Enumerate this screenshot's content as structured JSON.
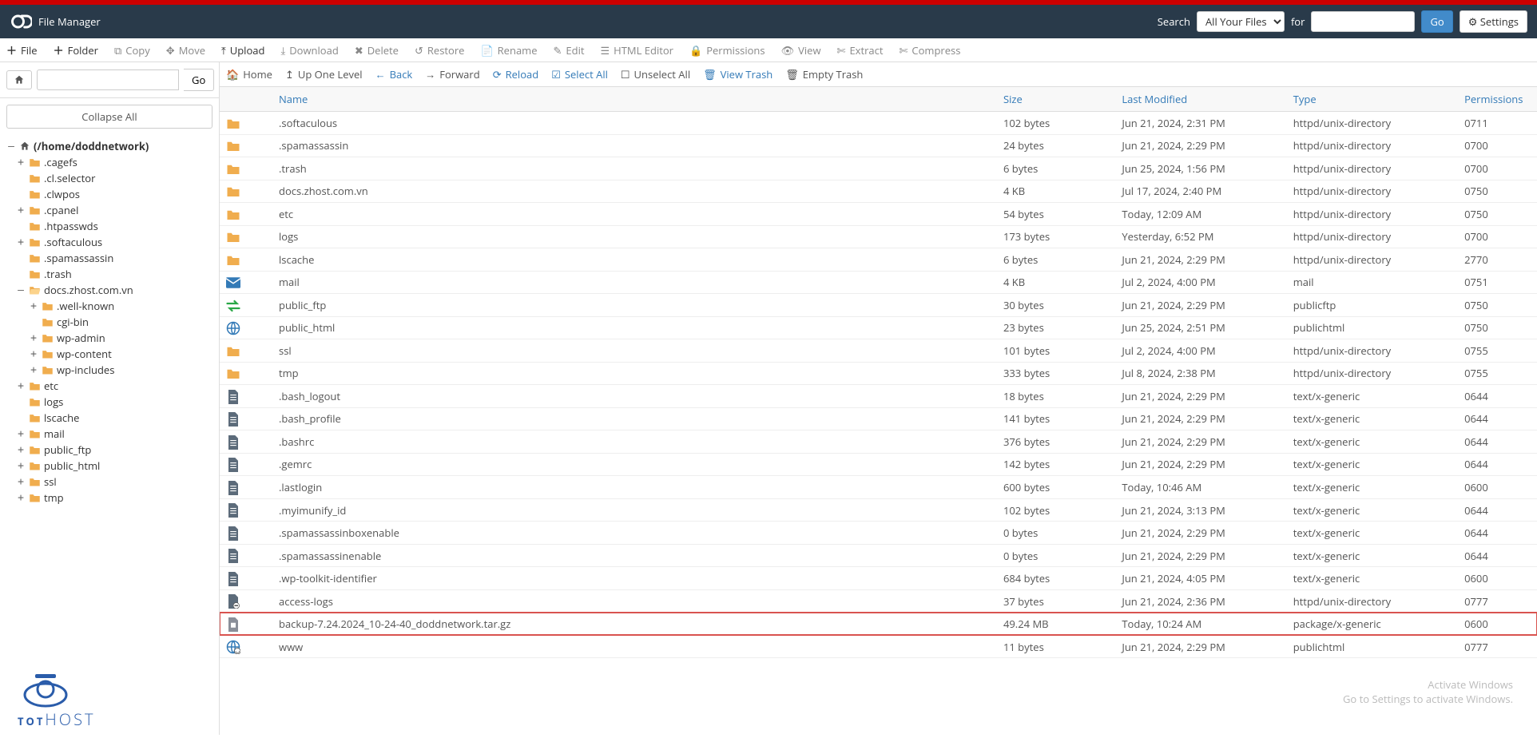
{
  "app_title": "File Manager",
  "search": {
    "label": "Search",
    "scope": "All Your Files",
    "for": "for",
    "go": "Go"
  },
  "settings_label": "Settings",
  "top_actions": [
    {
      "label": "File",
      "enabled": true,
      "icon": "plus"
    },
    {
      "label": "Folder",
      "enabled": true,
      "icon": "plus"
    },
    {
      "label": "Copy",
      "enabled": false,
      "icon": "copy"
    },
    {
      "label": "Move",
      "enabled": false,
      "icon": "move"
    },
    {
      "label": "Upload",
      "enabled": true,
      "icon": "upload"
    },
    {
      "label": "Download",
      "enabled": false,
      "icon": "download"
    },
    {
      "label": "Delete",
      "enabled": false,
      "icon": "x"
    },
    {
      "label": "Restore",
      "enabled": false,
      "icon": "restore"
    },
    {
      "label": "Rename",
      "enabled": false,
      "icon": "rename"
    },
    {
      "label": "Edit",
      "enabled": false,
      "icon": "edit"
    },
    {
      "label": "HTML Editor",
      "enabled": false,
      "icon": "html"
    },
    {
      "label": "Permissions",
      "enabled": false,
      "icon": "lock"
    },
    {
      "label": "View",
      "enabled": false,
      "icon": "eye"
    },
    {
      "label": "Extract",
      "enabled": false,
      "icon": "extract"
    },
    {
      "label": "Compress",
      "enabled": false,
      "icon": "compress"
    }
  ],
  "left": {
    "go": "Go",
    "collapse": "Collapse All",
    "root": "(/home/doddnetwork)",
    "tree": [
      {
        "d": 0,
        "tog": "–",
        "icon": "home",
        "label": "(/home/doddnetwork)",
        "bold": true,
        "open": true
      },
      {
        "d": 1,
        "tog": "+",
        "icon": "folder",
        "label": ".cagefs"
      },
      {
        "d": 1,
        "tog": "",
        "icon": "folder",
        "label": ".cl.selector"
      },
      {
        "d": 1,
        "tog": "",
        "icon": "folder",
        "label": ".clwpos"
      },
      {
        "d": 1,
        "tog": "+",
        "icon": "folder",
        "label": ".cpanel"
      },
      {
        "d": 1,
        "tog": "",
        "icon": "folder",
        "label": ".htpasswds"
      },
      {
        "d": 1,
        "tog": "+",
        "icon": "folder",
        "label": ".softaculous"
      },
      {
        "d": 1,
        "tog": "",
        "icon": "folder",
        "label": ".spamassassin"
      },
      {
        "d": 1,
        "tog": "",
        "icon": "folder",
        "label": ".trash"
      },
      {
        "d": 1,
        "tog": "–",
        "icon": "folder-open",
        "label": "docs.zhost.com.vn"
      },
      {
        "d": 2,
        "tog": "+",
        "icon": "folder",
        "label": ".well-known"
      },
      {
        "d": 2,
        "tog": "",
        "icon": "folder",
        "label": "cgi-bin"
      },
      {
        "d": 2,
        "tog": "+",
        "icon": "folder",
        "label": "wp-admin"
      },
      {
        "d": 2,
        "tog": "+",
        "icon": "folder",
        "label": "wp-content"
      },
      {
        "d": 2,
        "tog": "+",
        "icon": "folder",
        "label": "wp-includes"
      },
      {
        "d": 1,
        "tog": "+",
        "icon": "folder",
        "label": "etc"
      },
      {
        "d": 1,
        "tog": "",
        "icon": "folder",
        "label": "logs"
      },
      {
        "d": 1,
        "tog": "",
        "icon": "folder",
        "label": "lscache"
      },
      {
        "d": 1,
        "tog": "+",
        "icon": "folder",
        "label": "mail"
      },
      {
        "d": 1,
        "tog": "+",
        "icon": "folder",
        "label": "public_ftp"
      },
      {
        "d": 1,
        "tog": "+",
        "icon": "folder",
        "label": "public_html"
      },
      {
        "d": 1,
        "tog": "+",
        "icon": "folder",
        "label": "ssl"
      },
      {
        "d": 1,
        "tog": "+",
        "icon": "folder",
        "label": "tmp"
      }
    ]
  },
  "right_actions": [
    {
      "label": "Home",
      "icon": "home",
      "blue": false
    },
    {
      "label": "Up One Level",
      "icon": "up",
      "blue": false
    },
    {
      "label": "Back",
      "icon": "left",
      "blue": true
    },
    {
      "label": "Forward",
      "icon": "right",
      "blue": false
    },
    {
      "label": "Reload",
      "icon": "reload",
      "blue": true
    },
    {
      "label": "Select All",
      "icon": "check",
      "blue": true
    },
    {
      "label": "Unselect All",
      "icon": "uncheck",
      "blue": false
    },
    {
      "label": "View Trash",
      "icon": "trash",
      "blue": true
    },
    {
      "label": "Empty Trash",
      "icon": "trash",
      "blue": false
    }
  ],
  "columns": {
    "name": "Name",
    "size": "Size",
    "modified": "Last Modified",
    "type": "Type",
    "perm": "Permissions"
  },
  "rows": [
    {
      "icon": "folder",
      "name": ".softaculous",
      "size": "102 bytes",
      "mod": "Jun 21, 2024, 2:31 PM",
      "type": "httpd/unix-directory",
      "perm": "0711"
    },
    {
      "icon": "folder",
      "name": ".spamassassin",
      "size": "24 bytes",
      "mod": "Jun 21, 2024, 2:29 PM",
      "type": "httpd/unix-directory",
      "perm": "0700"
    },
    {
      "icon": "folder",
      "name": ".trash",
      "size": "6 bytes",
      "mod": "Jun 25, 2024, 1:56 PM",
      "type": "httpd/unix-directory",
      "perm": "0700"
    },
    {
      "icon": "folder",
      "name": "docs.zhost.com.vn",
      "size": "4 KB",
      "mod": "Jul 17, 2024, 2:40 PM",
      "type": "httpd/unix-directory",
      "perm": "0750"
    },
    {
      "icon": "folder",
      "name": "etc",
      "size": "54 bytes",
      "mod": "Today, 12:09 AM",
      "type": "httpd/unix-directory",
      "perm": "0750"
    },
    {
      "icon": "folder",
      "name": "logs",
      "size": "173 bytes",
      "mod": "Yesterday, 6:52 PM",
      "type": "httpd/unix-directory",
      "perm": "0700"
    },
    {
      "icon": "folder",
      "name": "lscache",
      "size": "6 bytes",
      "mod": "Jun 21, 2024, 2:29 PM",
      "type": "httpd/unix-directory",
      "perm": "2770"
    },
    {
      "icon": "mail",
      "name": "mail",
      "size": "4 KB",
      "mod": "Jul 2, 2024, 4:00 PM",
      "type": "mail",
      "perm": "0751"
    },
    {
      "icon": "ftp",
      "name": "public_ftp",
      "size": "30 bytes",
      "mod": "Jun 21, 2024, 2:29 PM",
      "type": "publicftp",
      "perm": "0750"
    },
    {
      "icon": "globe",
      "name": "public_html",
      "size": "23 bytes",
      "mod": "Jun 25, 2024, 2:51 PM",
      "type": "publichtml",
      "perm": "0750"
    },
    {
      "icon": "folder",
      "name": "ssl",
      "size": "101 bytes",
      "mod": "Jul 2, 2024, 4:00 PM",
      "type": "httpd/unix-directory",
      "perm": "0755"
    },
    {
      "icon": "folder",
      "name": "tmp",
      "size": "333 bytes",
      "mod": "Jul 8, 2024, 2:38 PM",
      "type": "httpd/unix-directory",
      "perm": "0755"
    },
    {
      "icon": "text",
      "name": ".bash_logout",
      "size": "18 bytes",
      "mod": "Jun 21, 2024, 2:29 PM",
      "type": "text/x-generic",
      "perm": "0644"
    },
    {
      "icon": "text",
      "name": ".bash_profile",
      "size": "141 bytes",
      "mod": "Jun 21, 2024, 2:29 PM",
      "type": "text/x-generic",
      "perm": "0644"
    },
    {
      "icon": "text",
      "name": ".bashrc",
      "size": "376 bytes",
      "mod": "Jun 21, 2024, 2:29 PM",
      "type": "text/x-generic",
      "perm": "0644"
    },
    {
      "icon": "text",
      "name": ".gemrc",
      "size": "142 bytes",
      "mod": "Jun 21, 2024, 2:29 PM",
      "type": "text/x-generic",
      "perm": "0644"
    },
    {
      "icon": "text",
      "name": ".lastlogin",
      "size": "600 bytes",
      "mod": "Today, 10:46 AM",
      "type": "text/x-generic",
      "perm": "0600"
    },
    {
      "icon": "text",
      "name": ".myimunify_id",
      "size": "102 bytes",
      "mod": "Jun 21, 2024, 3:13 PM",
      "type": "text/x-generic",
      "perm": "0644"
    },
    {
      "icon": "text",
      "name": ".spamassassinboxenable",
      "size": "0 bytes",
      "mod": "Jun 21, 2024, 2:29 PM",
      "type": "text/x-generic",
      "perm": "0644"
    },
    {
      "icon": "text",
      "name": ".spamassassinenable",
      "size": "0 bytes",
      "mod": "Jun 21, 2024, 2:29 PM",
      "type": "text/x-generic",
      "perm": "0644"
    },
    {
      "icon": "text",
      "name": ".wp-toolkit-identifier",
      "size": "684 bytes",
      "mod": "Jun 21, 2024, 4:05 PM",
      "type": "text/x-generic",
      "perm": "0600"
    },
    {
      "icon": "link",
      "name": "access-logs",
      "size": "37 bytes",
      "mod": "Jun 21, 2024, 2:36 PM",
      "type": "httpd/unix-directory",
      "perm": "0777"
    },
    {
      "icon": "pkg",
      "name": "backup-7.24.2024_10-24-40_doddnetwork.tar.gz",
      "size": "49.24 MB",
      "mod": "Today, 10:24 AM",
      "type": "package/x-generic",
      "perm": "0600",
      "hl": true
    },
    {
      "icon": "globelink",
      "name": "www",
      "size": "11 bytes",
      "mod": "Jun 21, 2024, 2:29 PM",
      "type": "publichtml",
      "perm": "0777"
    }
  ],
  "watermark": {
    "title": "Activate Windows",
    "sub": "Go to Settings to activate Windows."
  },
  "brand": "TOTHOST"
}
